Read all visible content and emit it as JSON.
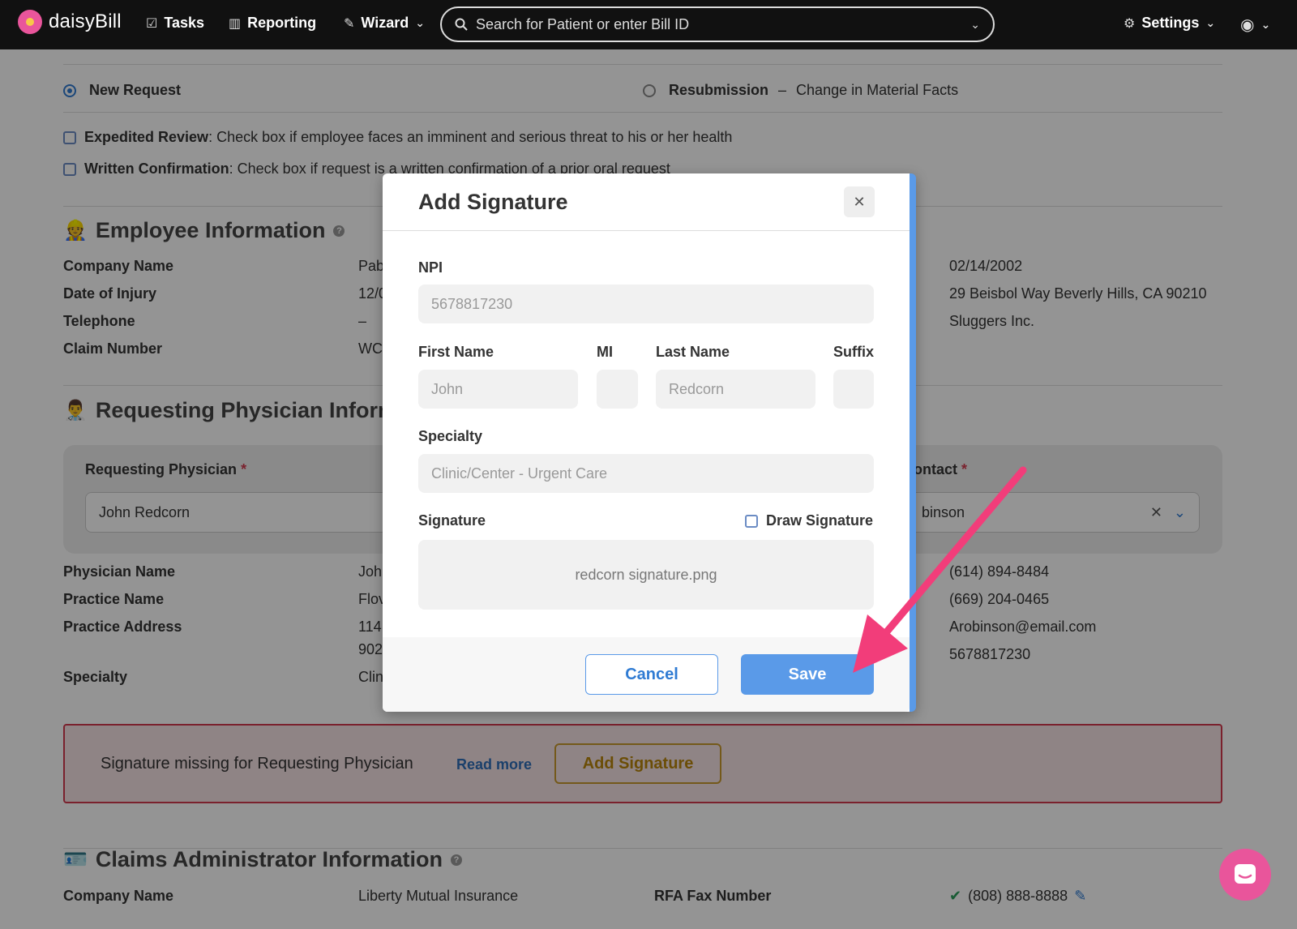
{
  "nav": {
    "logo_text": "daisyBill",
    "items": [
      {
        "label": "Tasks",
        "icon": "clipboard-check-icon"
      },
      {
        "label": "Reporting",
        "icon": "bar-chart-icon"
      },
      {
        "label": "Wizard",
        "icon": "magic-wand-icon"
      }
    ],
    "search_placeholder": "Search for Patient or enter Bill ID",
    "settings_label": "Settings"
  },
  "request": {
    "new_request": "New Request",
    "resubmission": "Resubmission",
    "dash": "–",
    "resubmission_reason": "Change in Material Facts",
    "expedited_label": "Expedited Review",
    "expedited_text": ": Check box if employee faces an imminent and serious threat to his or her health",
    "written_label": "Written Confirmation",
    "written_text": ": Check box if request is a written confirmation of a prior oral request"
  },
  "employee": {
    "title": "Employee Information",
    "fields": [
      {
        "label": "Company Name",
        "value": "Pab"
      },
      {
        "label": "Date of Injury",
        "value": "12/0"
      },
      {
        "label": "Telephone",
        "value": "–"
      },
      {
        "label": "Claim Number",
        "value": "WC"
      }
    ],
    "right_values": [
      "02/14/2002",
      "29 Beisbol Way Beverly Hills, CA 90210",
      "Sluggers Inc."
    ]
  },
  "physician": {
    "title": "Requesting Physician Informa",
    "requesting_label": "Requesting Physician",
    "requesting_value": "John Redcorn",
    "contact_label": "ontact",
    "contact_value": "binson",
    "fields": [
      {
        "label": "Physician Name",
        "value": "Joh"
      },
      {
        "label": "Practice Name",
        "value": "Flov"
      },
      {
        "label": "Practice Address",
        "value": "114 ("
      },
      {
        "label": "",
        "value": "902"
      },
      {
        "label": "Specialty",
        "value": "Clin"
      }
    ],
    "right_values": [
      "(614) 894-8484",
      "(669) 204-0465",
      "Arobinson@email.com",
      "5678817230"
    ]
  },
  "warning": {
    "text": "Signature missing for Requesting Physician",
    "read_more": "Read more",
    "add_signature": "Add Signature"
  },
  "claims": {
    "title": "Claims Administrator Information",
    "company_label": "Company Name",
    "company_value": "Liberty Mutual Insurance",
    "fax_label": "RFA Fax Number",
    "fax_value": "(808) 888-8888"
  },
  "modal": {
    "title": "Add Signature",
    "npi_label": "NPI",
    "npi_value": "5678817230",
    "first_name_label": "First Name",
    "first_name_value": "John",
    "mi_label": "MI",
    "mi_value": "",
    "last_name_label": "Last Name",
    "last_name_value": "Redcorn",
    "suffix_label": "Suffix",
    "suffix_value": "",
    "specialty_label": "Specialty",
    "specialty_value": "Clinic/Center - Urgent Care",
    "signature_label": "Signature",
    "draw_signature_label": "Draw Signature",
    "signature_file": "redcorn signature.png",
    "cancel": "Cancel",
    "save": "Save"
  },
  "colors": {
    "accent": "#5a9ae8",
    "brand_pink": "#e9559b",
    "warning_red": "#d33a4f",
    "gold": "#c99a2e",
    "arrow": "#f23d7a"
  }
}
